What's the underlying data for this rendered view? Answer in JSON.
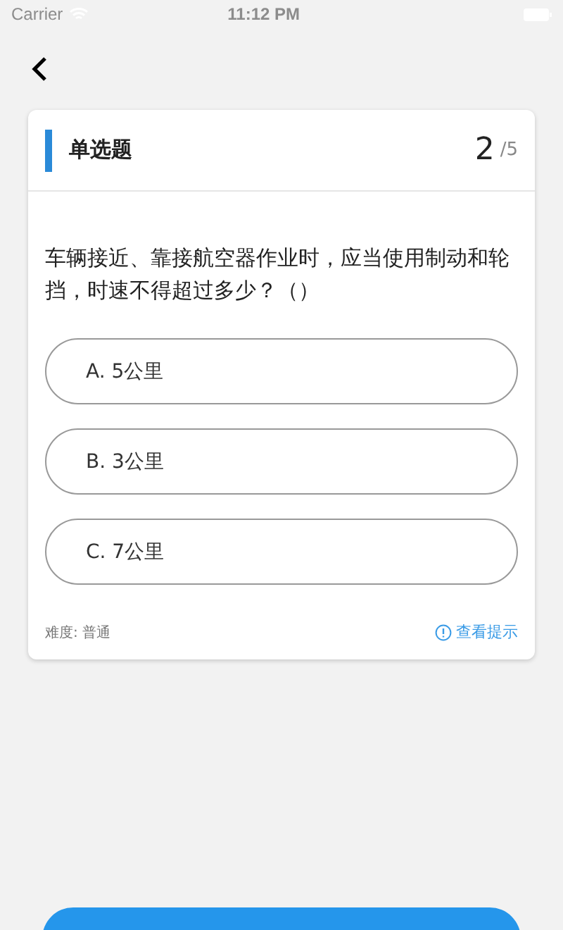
{
  "status_bar": {
    "carrier": "Carrier",
    "time": "11:12 PM"
  },
  "card": {
    "type_label": "单选题",
    "current": "2",
    "total": "/5",
    "question": "车辆接近、靠接航空器作业时，应当使用制动和轮挡，时速不得超过多少？（）",
    "options": [
      {
        "label": "A. 5公里",
        "selected": false
      },
      {
        "label": "B. 3公里",
        "selected": false
      },
      {
        "label": "C. 7公里",
        "selected": false
      }
    ],
    "difficulty": "难度: 普通",
    "hint_link": "查看提示"
  }
}
